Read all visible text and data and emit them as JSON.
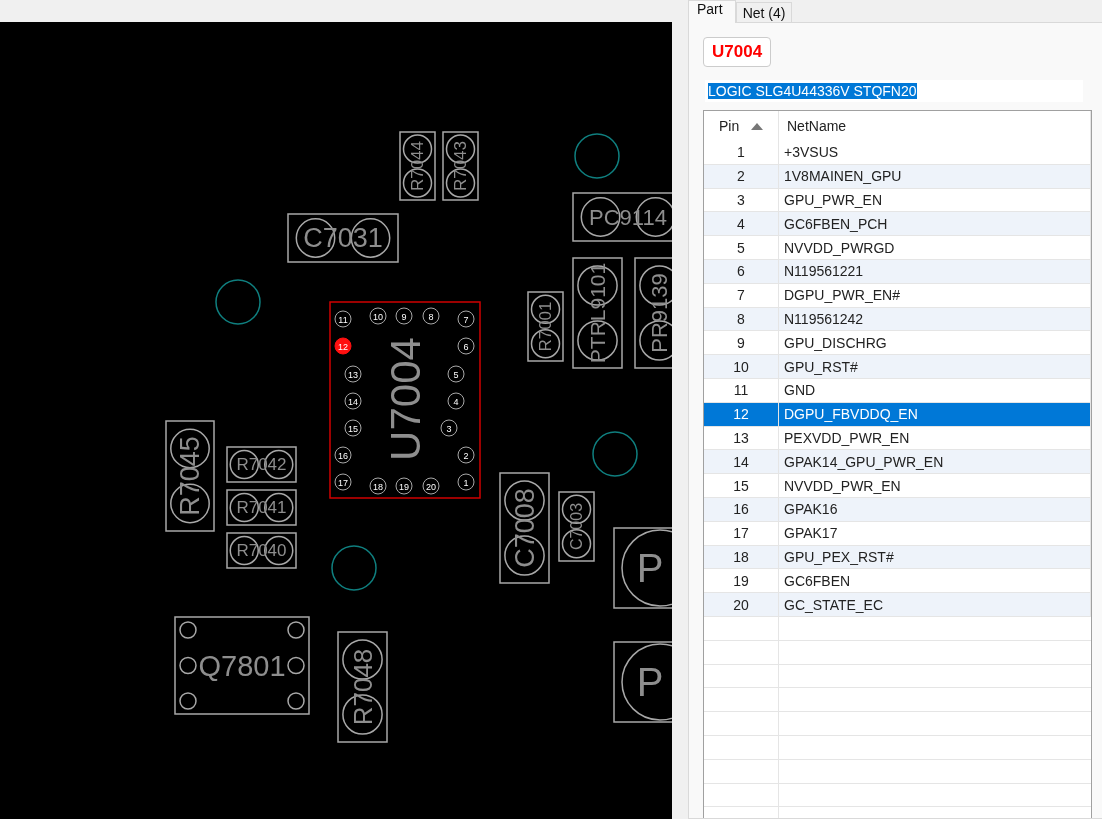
{
  "board": {
    "components": [
      {
        "kind": "two-pad",
        "designator": "R7044"
      },
      {
        "kind": "two-pad",
        "designator": "R7043"
      },
      {
        "kind": "two-pad",
        "designator": "C7031"
      },
      {
        "kind": "two-pad",
        "designator": "PC9114"
      },
      {
        "kind": "two-pad",
        "designator": "PTRL9101"
      },
      {
        "kind": "two-pad",
        "designator": "PR9139"
      },
      {
        "kind": "two-pad",
        "designator": "R7001"
      },
      {
        "kind": "two-pad",
        "designator": "R7045"
      },
      {
        "kind": "two-pad",
        "designator": "R7042"
      },
      {
        "kind": "two-pad",
        "designator": "R7041"
      },
      {
        "kind": "two-pad",
        "designator": "R7040"
      },
      {
        "kind": "two-pad",
        "designator": "C7008"
      },
      {
        "kind": "two-pad",
        "designator": "C7003"
      },
      {
        "kind": "single-pad",
        "designator": "P"
      },
      {
        "kind": "single-pad",
        "designator": "P"
      },
      {
        "kind": "six-pad",
        "designator": "Q7801"
      },
      {
        "kind": "two-pad",
        "designator": "R7048"
      }
    ],
    "chip": {
      "designator": "U7004",
      "selected": true,
      "pins": [
        {
          "label": "11",
          "selected": false
        },
        {
          "label": "10",
          "selected": false
        },
        {
          "label": "9",
          "selected": false
        },
        {
          "label": "8",
          "selected": false
        },
        {
          "label": "7",
          "selected": false
        },
        {
          "label": "12",
          "selected": true
        },
        {
          "label": "6",
          "selected": false
        },
        {
          "label": "13",
          "selected": false
        },
        {
          "label": "5",
          "selected": false
        },
        {
          "label": "14",
          "selected": false
        },
        {
          "label": "4",
          "selected": false
        },
        {
          "label": "15",
          "selected": false
        },
        {
          "label": "3",
          "selected": false
        },
        {
          "label": "16",
          "selected": false
        },
        {
          "label": "2",
          "selected": false
        },
        {
          "label": "17",
          "selected": false
        },
        {
          "label": "18",
          "selected": false
        },
        {
          "label": "19",
          "selected": false
        },
        {
          "label": "20",
          "selected": false
        },
        {
          "label": "1",
          "selected": false
        }
      ]
    }
  },
  "tabs": [
    {
      "label": "Part",
      "selected": true
    },
    {
      "label": "Net (4)",
      "selected": false
    }
  ],
  "part_button": "U7004",
  "description": {
    "value": "LOGIC SLG4U44336V STQFN20",
    "selected": true
  },
  "table": {
    "columns": [
      {
        "label": "Pin",
        "sorted": true
      },
      {
        "label": "NetName",
        "sorted": false
      }
    ],
    "rows": [
      {
        "pin": "1",
        "net": "+3VSUS",
        "selected": false
      },
      {
        "pin": "2",
        "net": "1V8MAINEN_GPU",
        "selected": false
      },
      {
        "pin": "3",
        "net": "GPU_PWR_EN",
        "selected": false
      },
      {
        "pin": "4",
        "net": "GC6FBEN_PCH",
        "selected": false
      },
      {
        "pin": "5",
        "net": "NVVDD_PWRGD",
        "selected": false
      },
      {
        "pin": "6",
        "net": "N119561221",
        "selected": false
      },
      {
        "pin": "7",
        "net": "DGPU_PWR_EN#",
        "selected": false
      },
      {
        "pin": "8",
        "net": "N119561242",
        "selected": false
      },
      {
        "pin": "9",
        "net": "GPU_DISCHRG",
        "selected": false
      },
      {
        "pin": "10",
        "net": "GPU_RST#",
        "selected": false
      },
      {
        "pin": "11",
        "net": "GND",
        "selected": false
      },
      {
        "pin": "12",
        "net": "DGPU_FBVDDQ_EN",
        "selected": true
      },
      {
        "pin": "13",
        "net": "PEXVDD_PWR_EN",
        "selected": false
      },
      {
        "pin": "14",
        "net": "GPAK14_GPU_PWR_EN",
        "selected": false
      },
      {
        "pin": "15",
        "net": "NVVDD_PWR_EN",
        "selected": false
      },
      {
        "pin": "16",
        "net": "GPAK16",
        "selected": false
      },
      {
        "pin": "17",
        "net": "GPAK17",
        "selected": false
      },
      {
        "pin": "18",
        "net": "GPU_PEX_RST#",
        "selected": false
      },
      {
        "pin": "19",
        "net": "GC6FBEN",
        "selected": false
      },
      {
        "pin": "20",
        "net": "GC_STATE_EC",
        "selected": false
      }
    ]
  }
}
